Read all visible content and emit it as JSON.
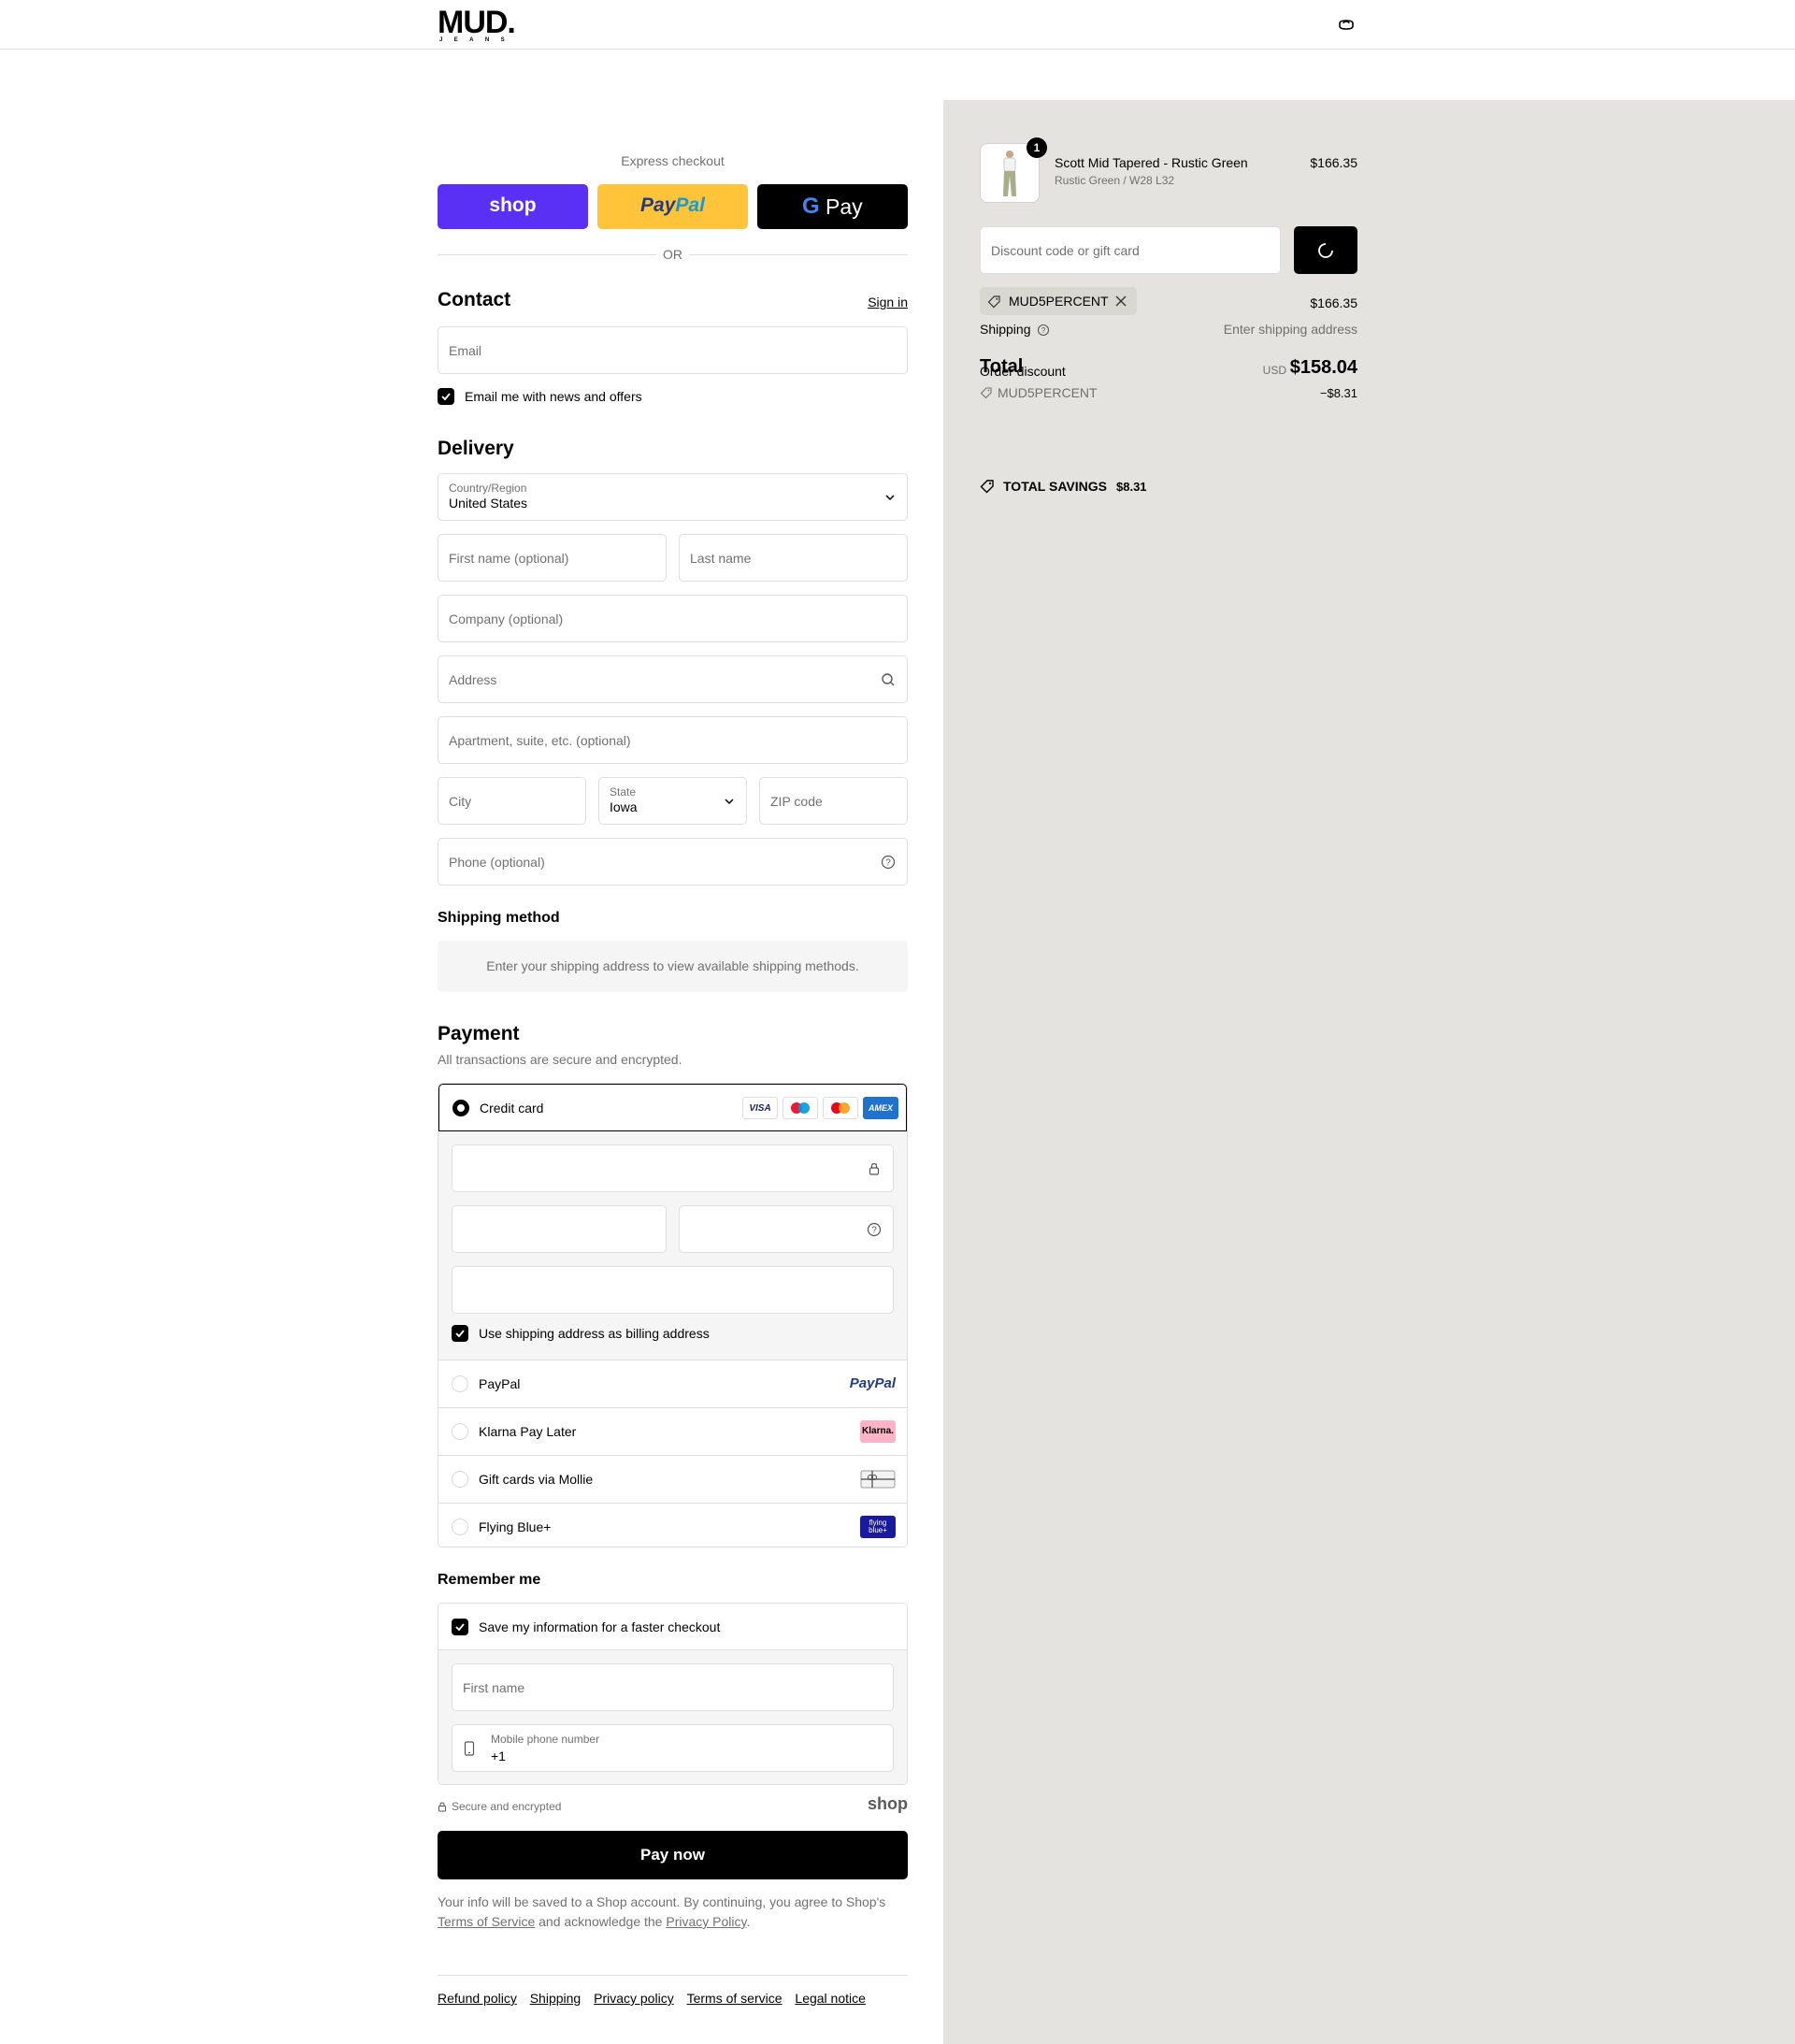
{
  "header": {
    "brand": "MUD.",
    "brand_sub": "JEANS"
  },
  "express": {
    "title": "Express checkout",
    "shop_label": "shop",
    "paypal_label_pay": "Pay",
    "paypal_label_pal": "Pal",
    "gpay_label": "Pay",
    "or_label": "OR"
  },
  "contact": {
    "title": "Contact",
    "sign_in": "Sign in",
    "email_placeholder": "Email",
    "news_label": "Email me with news and offers"
  },
  "delivery": {
    "title": "Delivery",
    "country_label": "Country/Region",
    "country_value": "United States",
    "first_name": "First name (optional)",
    "last_name": "Last name",
    "company": "Company (optional)",
    "address": "Address",
    "apartment": "Apartment, suite, etc. (optional)",
    "city": "City",
    "state_label": "State",
    "state_value": "Iowa",
    "zip": "ZIP code",
    "phone": "Phone (optional)"
  },
  "shipping_method": {
    "title": "Shipping method",
    "notice": "Enter your shipping address to view available shipping methods."
  },
  "payment": {
    "title": "Payment",
    "subtitle": "All transactions are secure and encrypted.",
    "credit_card": "Credit card",
    "card_badges": [
      "VISA",
      "maestro",
      "mastercard",
      "AMEX"
    ],
    "billing_same": "Use shipping address as billing address",
    "methods": [
      {
        "label": "PayPal",
        "logo": "PayPal"
      },
      {
        "label": "Klarna Pay Later",
        "logo": "Klarna."
      },
      {
        "label": "Gift cards via Mollie",
        "logo": "gift-card-icon"
      },
      {
        "label": "Flying Blue+",
        "logo": "flying blue+"
      }
    ]
  },
  "remember": {
    "title": "Remember me",
    "save_label": "Save my information for a faster checkout",
    "first_name": "First name",
    "mobile_label": "Mobile phone number",
    "mobile_value": "+1",
    "secure": "Secure and encrypted",
    "shop_mark": "shop"
  },
  "pay_button": "Pay now",
  "legal": {
    "line1": "Your info will be saved to a Shop account. By continuing, you agree to Shop's",
    "terms": "Terms of Service",
    "and_ack": " and acknowledge the ",
    "privacy": "Privacy Policy",
    "period": "."
  },
  "footer_links": [
    "Refund policy",
    "Shipping",
    "Privacy policy",
    "Terms of service",
    "Legal notice"
  ],
  "summary": {
    "product_name": "Scott Mid Tapered - Rustic Green",
    "product_variant": "Rustic Green / W28 L32",
    "product_qty": "1",
    "product_price": "$166.35",
    "discount_placeholder": "Discount code or gift card",
    "applied_code": "MUD5PERCENT",
    "subtotal_value": "$166.35",
    "shipping_label": "Shipping",
    "shipping_value": "Enter shipping address",
    "total_label": "Total",
    "order_discount_label": "Order discount",
    "currency": "USD",
    "total_value": "$158.04",
    "discount_code": "MUD5PERCENT",
    "discount_value": "−$8.31",
    "savings_label": "TOTAL SAVINGS",
    "savings_value": "$8.31"
  },
  "colors": {
    "shop": "#5a31f4",
    "paypal": "#ffc439",
    "gpay": "#000000",
    "summary_bg": "#e4e3df"
  }
}
